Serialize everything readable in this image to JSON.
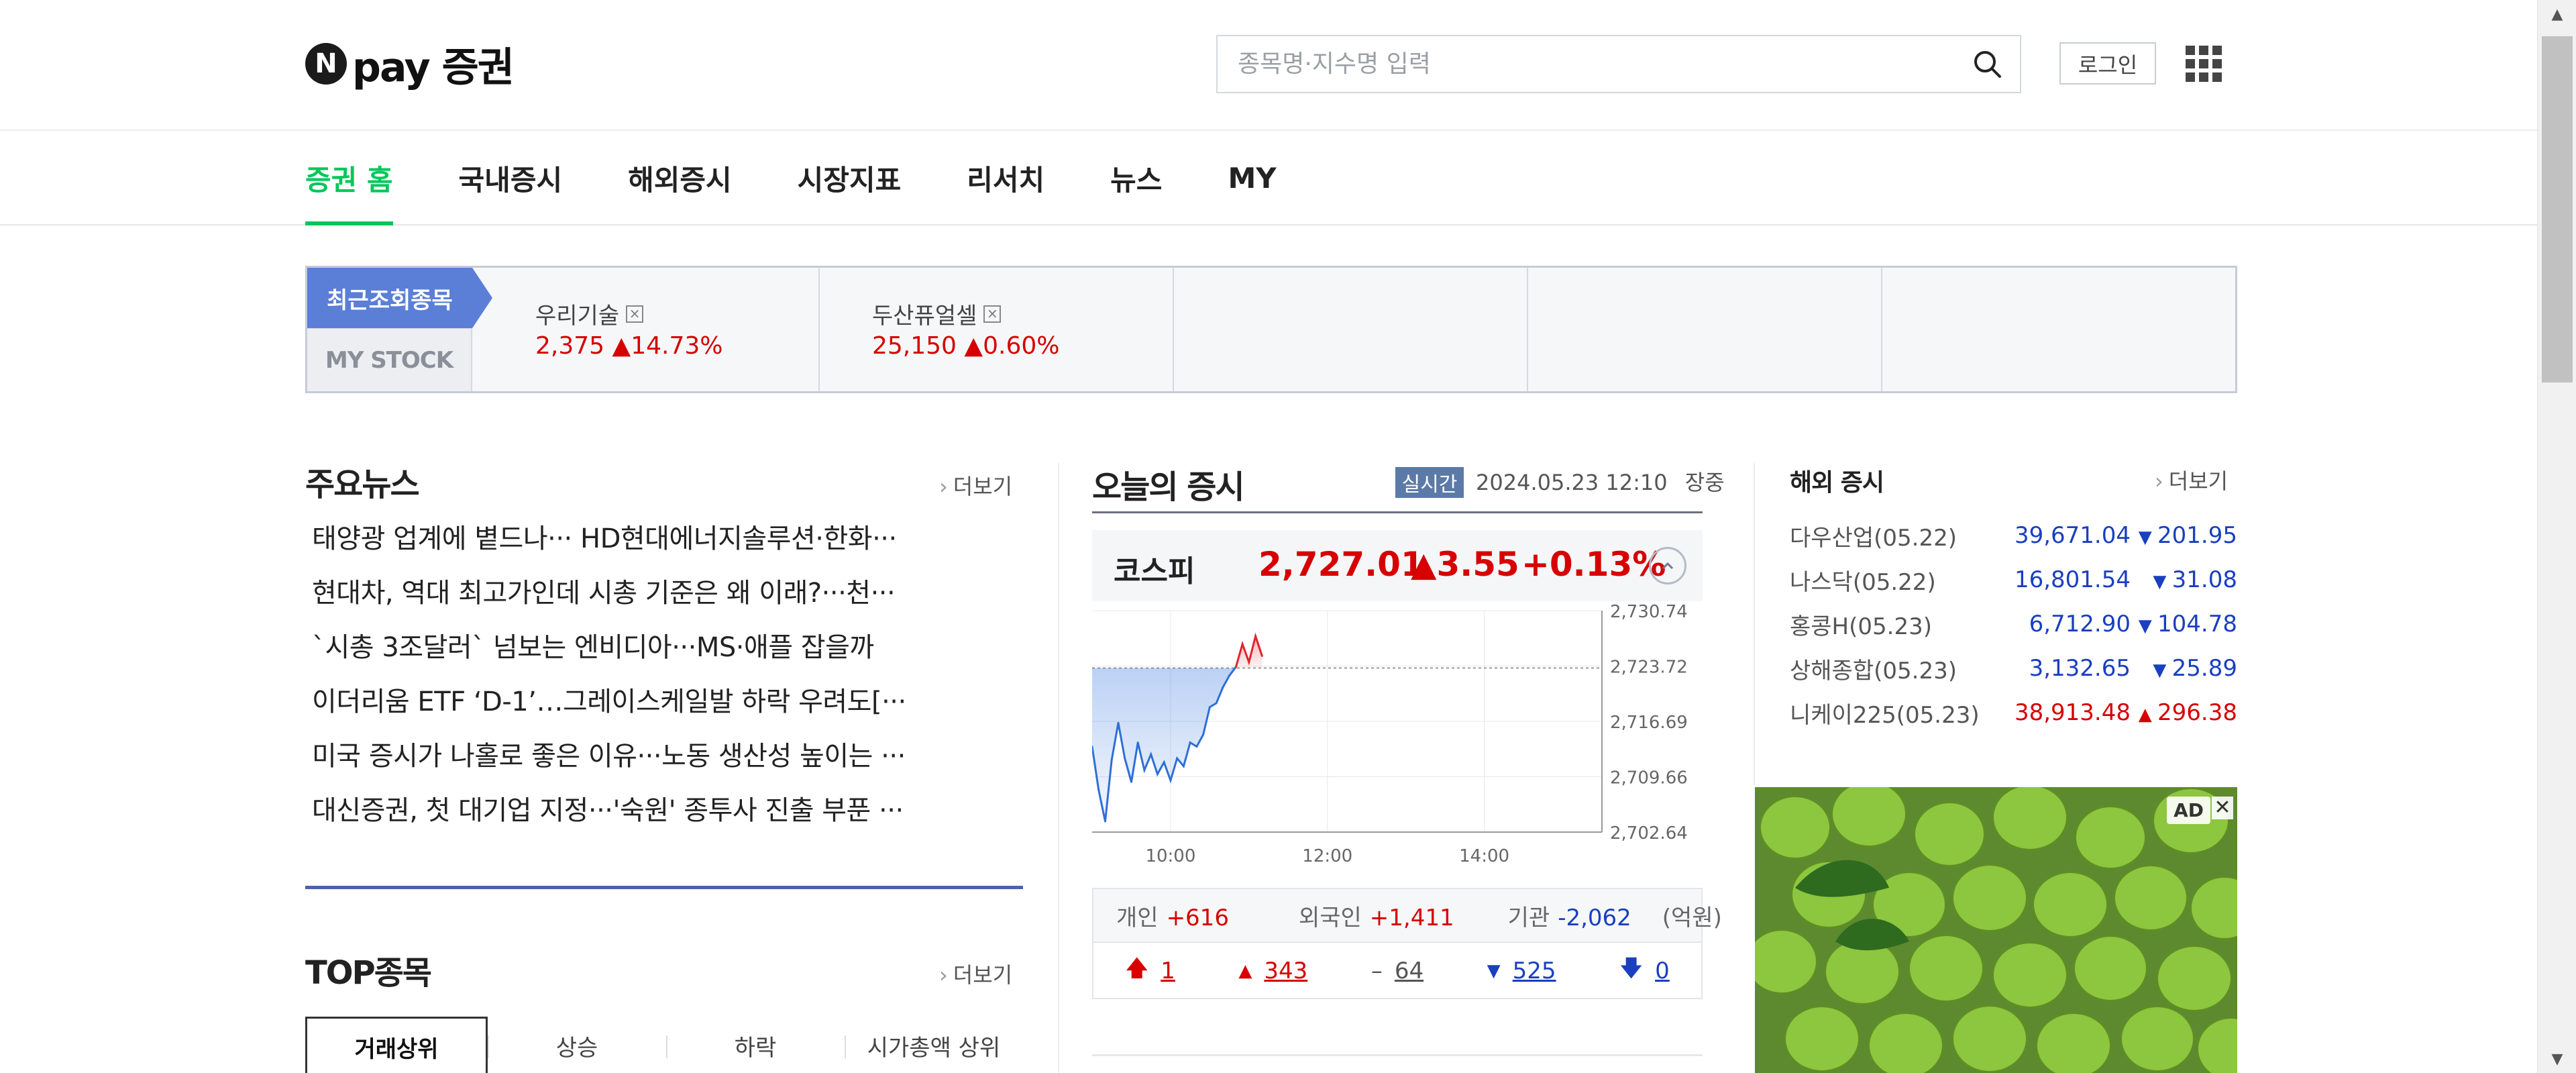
{
  "header": {
    "logo_text": "pay 증권",
    "logo_badge": "N",
    "search_placeholder": "종목명·지수명 입력",
    "login_label": "로그인"
  },
  "nav": {
    "items": [
      "증권 홈",
      "국내증시",
      "해외증시",
      "시장지표",
      "리서치",
      "뉴스",
      "MY"
    ]
  },
  "recent": {
    "tab_recent": "최근조회종목",
    "tab_mystock": "MY STOCK",
    "items": [
      {
        "name": "우리기술",
        "price": "2,375",
        "change": "14.73%"
      },
      {
        "name": "두산퓨얼셀",
        "price": "25,150",
        "change": "0.60%"
      }
    ]
  },
  "news": {
    "title": "주요뉴스",
    "more": "더보기",
    "items": [
      "태양광 업계에 볕드나··· HD현대에너지솔루션·한화···",
      "현대차, 역대 최고가인데 시총 기준은 왜 이래?···천···",
      "`시총 3조달러` 넘보는 엔비디아···MS·애플 잡을까",
      "이더리움 ETF ‘D-1’…그레이스케일발 하락 우려도[···",
      "미국 증시가 나홀로 좋은 이유···노동 생산성 높이는 ···",
      "대신증권, 첫 대기업 지정···'숙원' 종투사 진출 부푼 ···"
    ]
  },
  "top": {
    "title": "TOP종목",
    "more": "더보기",
    "tabs": [
      "거래상위",
      "상승",
      "하락",
      "시가총액 상위"
    ]
  },
  "market": {
    "title": "오늘의 증시",
    "realtime": "실시간",
    "datetime": "2024.05.23 12:10",
    "status": "장중",
    "index_name": "코스피",
    "index_value": "2,727.01",
    "index_change": "3.55",
    "index_pct": "+0.13%",
    "investors": [
      {
        "label": "개인",
        "value": "+616",
        "tone": "up"
      },
      {
        "label": "외국인",
        "value": "+1,411",
        "tone": "up"
      },
      {
        "label": "기관",
        "value": "-2,062",
        "tone": "dn"
      }
    ],
    "unit": "(억원)",
    "counts": {
      "upper_limit": "1",
      "up": "343",
      "flat": "64",
      "down": "525",
      "lower_limit": "0"
    }
  },
  "chart_data": {
    "type": "line",
    "x_ticks": [
      "10:00",
      "12:00",
      "14:00"
    ],
    "y_ticks": [
      "2,730.74",
      "2,723.72",
      "2,716.69",
      "2,709.66",
      "2,702.64"
    ],
    "ylim": [
      2702.64,
      2730.74
    ],
    "reference_line": 2723.46,
    "colors": {
      "below": "#2f6fd6",
      "above": "#e0242f"
    },
    "x_minutes": [
      0,
      5,
      10,
      15,
      20,
      25,
      30,
      35,
      40,
      45,
      50,
      55,
      60,
      65,
      70,
      75,
      80,
      85,
      90,
      95,
      100,
      105,
      110,
      115,
      120,
      125,
      130
    ],
    "y": [
      2713.5,
      2708.0,
      2704.0,
      2711.8,
      2716.5,
      2712.0,
      2709.0,
      2714.0,
      2710.5,
      2712.5,
      2710.0,
      2711.5,
      2709.2,
      2712.0,
      2711.0,
      2714.0,
      2713.5,
      2715.0,
      2718.5,
      2719.0,
      2721.0,
      2722.5,
      2723.6,
      2726.5,
      2724.2,
      2727.5,
      2725.0
    ]
  },
  "overseas": {
    "title": "해외 증시",
    "more": "더보기",
    "items": [
      {
        "name": "다우산업(05.22)",
        "price": "39,671.04",
        "change": "201.95",
        "dir": "dn"
      },
      {
        "name": "나스닥(05.22)",
        "price": "16,801.54",
        "change": "31.08",
        "dir": "dn"
      },
      {
        "name": "홍콩H(05.23)",
        "price": "6,712.90",
        "change": "104.78",
        "dir": "dn"
      },
      {
        "name": "상해종합(05.23)",
        "price": "3,132.65",
        "change": "25.89",
        "dir": "dn"
      },
      {
        "name": "니케이225(05.23)",
        "price": "38,913.48",
        "change": "296.38",
        "dir": "up"
      }
    ]
  },
  "ad": {
    "label": "AD",
    "close": "✕"
  },
  "scroll": {
    "up_glyph": "▲",
    "down_glyph": "▼"
  }
}
